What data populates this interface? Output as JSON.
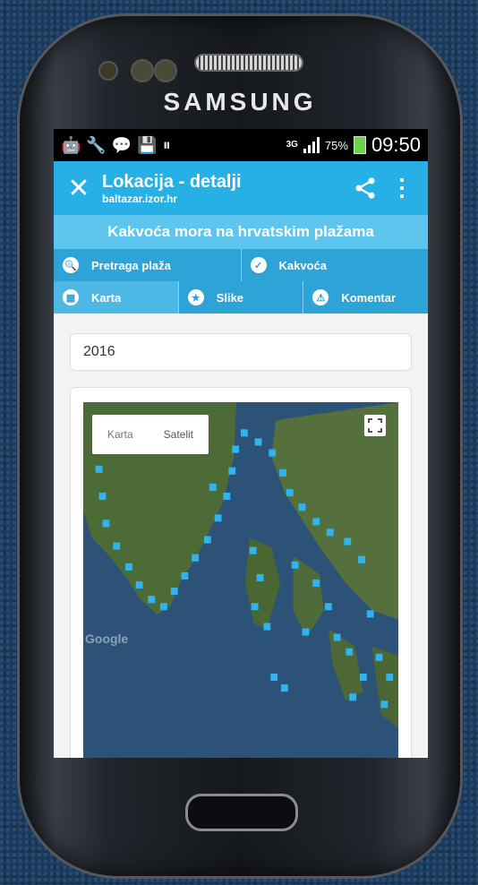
{
  "device": {
    "brand": "SAMSUNG"
  },
  "status_bar": {
    "network": "3G",
    "battery_percent": "75%",
    "time": "09:50"
  },
  "app_bar": {
    "title": "Lokacija - detalji",
    "subtitle": "baltazar.izor.hr",
    "close_icon": "close-icon",
    "share_icon": "share-icon",
    "menu_icon": "more-vert-icon"
  },
  "banner": {
    "text": "Kakvoća mora na hrvatskim plažama"
  },
  "tabs_row1": [
    {
      "label": "Pretraga plaža",
      "icon": "search-icon"
    },
    {
      "label": "Kakvoća",
      "icon": "check-icon"
    }
  ],
  "tabs_row2": [
    {
      "label": "Karta",
      "icon": "grid-icon",
      "active": true
    },
    {
      "label": "Slike",
      "icon": "star-icon"
    },
    {
      "label": "Komentar",
      "icon": "warning-icon"
    }
  ],
  "year": "2016",
  "map": {
    "toggle": [
      "Karta",
      "Satelit"
    ],
    "watermark": "Google",
    "marker_color": "#2fb4f0",
    "sea_color": "#30557a",
    "land_color": "#4d6b37"
  }
}
